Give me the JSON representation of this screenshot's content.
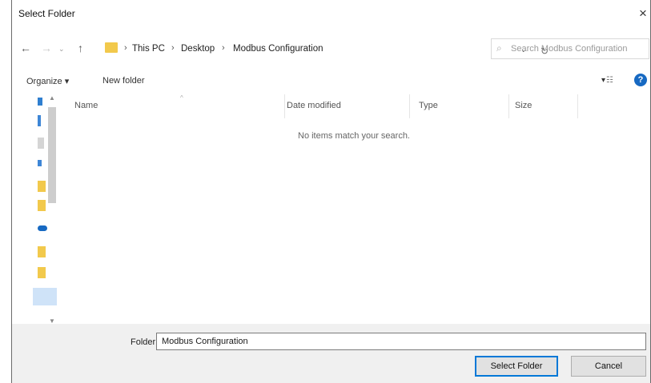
{
  "window": {
    "title": "Select Folder",
    "close": "×"
  },
  "nav": {
    "back": "←",
    "forward": "→",
    "recent": "⌄",
    "up": "↑"
  },
  "address": {
    "crumbs": [
      "This PC",
      "Desktop",
      "Modbus Configuration"
    ],
    "separator": "›",
    "dropdown": "⌄",
    "refresh": "↻"
  },
  "search": {
    "placeholder": "Search Modbus Configuration",
    "icon": "search-icon"
  },
  "toolbar": {
    "organize": "Organize ▾",
    "new_folder": "New folder",
    "view_dd": "▾",
    "help": "?"
  },
  "columns": [
    "Name",
    "Date modified",
    "Type",
    "Size"
  ],
  "empty_message": "No items match your search.",
  "footer": {
    "folder_label": "Folder:",
    "folder_value": "Modbus Configuration",
    "select_button": "Select Folder",
    "cancel_button": "Cancel"
  },
  "colors": {
    "accent": "#0078d7",
    "annotation_arrow": "#e00000",
    "folder": "#f2c94c",
    "onedrive": "#1769c2"
  }
}
